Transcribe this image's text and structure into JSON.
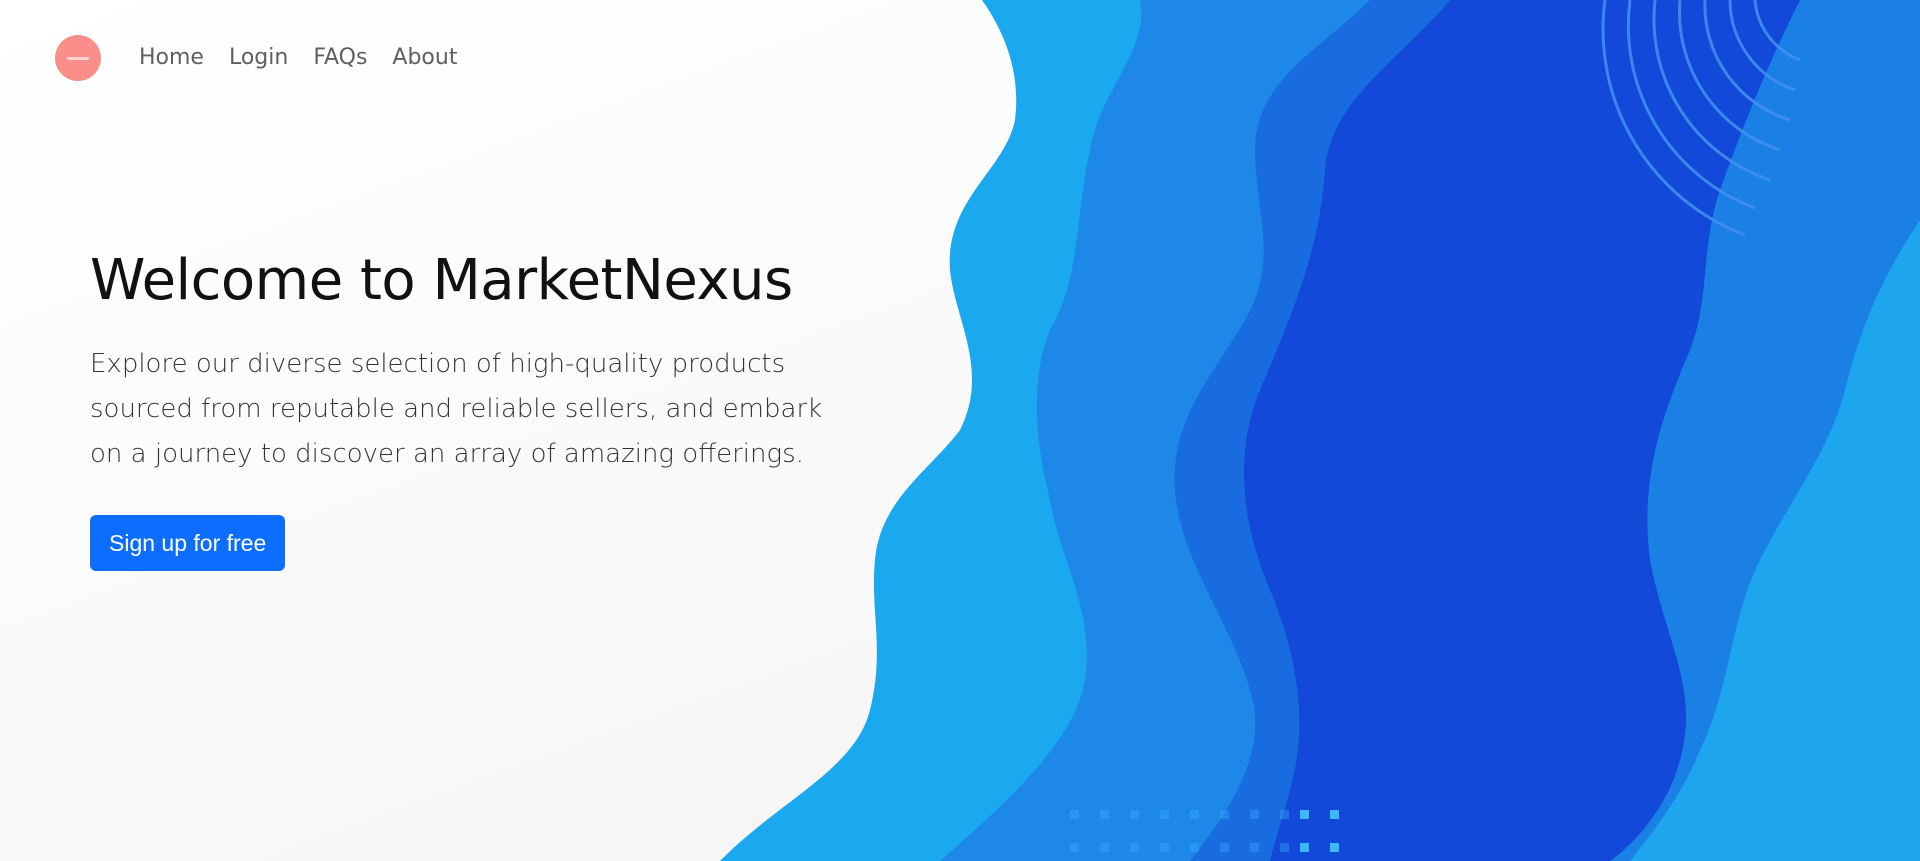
{
  "navbar": {
    "logo_icon": "brand-logo-icon",
    "logo_color": "#f98e8a",
    "links": [
      {
        "label": "Home"
      },
      {
        "label": "Login"
      },
      {
        "label": "FAQs"
      },
      {
        "label": "About"
      }
    ]
  },
  "hero": {
    "title": "Welcome to MarketNexus",
    "lede": "Explore our diverse selection of high-quality products sourced from reputable and reliable sellers, and embark on a journey to discover an array of amazing offerings.",
    "cta_label": "Sign up for free",
    "cta_color": "#0d6efd"
  },
  "background": {
    "illustration": "blue-fluid-waves-illustration",
    "colors": [
      "#1aa8ee",
      "#1e88e8",
      "#196be0",
      "#1249d9"
    ]
  }
}
